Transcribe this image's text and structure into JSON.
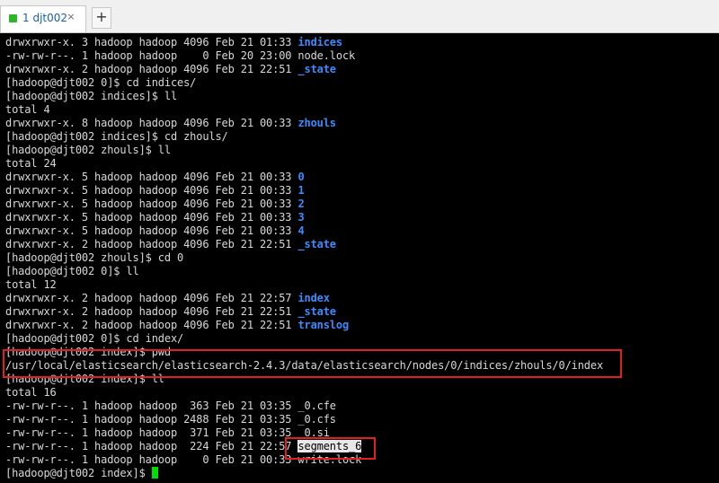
{
  "tab": {
    "label": "1 djt002",
    "close": "×",
    "new": "+"
  },
  "terminal": {
    "lines": [
      {
        "prefix": "drwxrwxr-x. 3 hadoop hadoop 4096 Feb 21 01:33 ",
        "name": "indices"
      },
      {
        "prefix": "-rw-rw-r--. 1 hadoop hadoop    0 Feb 20 23:00 node.lock",
        "name": ""
      },
      {
        "prefix": "drwxrwxr-x. 2 hadoop hadoop 4096 Feb 21 22:51 ",
        "name": "_state"
      },
      {
        "prefix": "[hadoop@djt002 0]$ cd indices/",
        "name": ""
      },
      {
        "prefix": "[hadoop@djt002 indices]$ ll",
        "name": ""
      },
      {
        "prefix": "total 4",
        "name": ""
      },
      {
        "prefix": "drwxrwxr-x. 8 hadoop hadoop 4096 Feb 21 00:33 ",
        "name": "zhouls"
      },
      {
        "prefix": "[hadoop@djt002 indices]$ cd zhouls/",
        "name": ""
      },
      {
        "prefix": "[hadoop@djt002 zhouls]$ ll",
        "name": ""
      },
      {
        "prefix": "total 24",
        "name": ""
      },
      {
        "prefix": "drwxrwxr-x. 5 hadoop hadoop 4096 Feb 21 00:33 ",
        "name": "0"
      },
      {
        "prefix": "drwxrwxr-x. 5 hadoop hadoop 4096 Feb 21 00:33 ",
        "name": "1"
      },
      {
        "prefix": "drwxrwxr-x. 5 hadoop hadoop 4096 Feb 21 00:33 ",
        "name": "2"
      },
      {
        "prefix": "drwxrwxr-x. 5 hadoop hadoop 4096 Feb 21 00:33 ",
        "name": "3"
      },
      {
        "prefix": "drwxrwxr-x. 5 hadoop hadoop 4096 Feb 21 00:33 ",
        "name": "4"
      },
      {
        "prefix": "drwxrwxr-x. 2 hadoop hadoop 4096 Feb 21 22:51 ",
        "name": "_state"
      },
      {
        "prefix": "[hadoop@djt002 zhouls]$ cd 0",
        "name": ""
      },
      {
        "prefix": "[hadoop@djt002 0]$ ll",
        "name": ""
      },
      {
        "prefix": "total 12",
        "name": ""
      },
      {
        "prefix": "drwxrwxr-x. 2 hadoop hadoop 4096 Feb 21 22:57 ",
        "name": "index"
      },
      {
        "prefix": "drwxrwxr-x. 2 hadoop hadoop 4096 Feb 21 22:51 ",
        "name": "_state"
      },
      {
        "prefix": "drwxrwxr-x. 2 hadoop hadoop 4096 Feb 21 22:51 ",
        "name": "translog"
      },
      {
        "prefix": "[hadoop@djt002 0]$ cd index/",
        "name": ""
      },
      {
        "prefix": "[hadoop@djt002 index]$ pwd",
        "name": ""
      },
      {
        "prefix": "/usr/local/elasticsearch/elasticsearch-2.4.3/data/elasticsearch/nodes/0/indices/zhouls/0/index",
        "name": ""
      },
      {
        "prefix": "[hadoop@djt002 index]$ ll",
        "name": ""
      },
      {
        "prefix": "total 16",
        "name": ""
      },
      {
        "prefix": "-rw-rw-r--. 1 hadoop hadoop  363 Feb 21 03:35 _0.cfe",
        "name": ""
      },
      {
        "prefix": "-rw-rw-r--. 1 hadoop hadoop 2488 Feb 21 03:35 _0.cfs",
        "name": ""
      },
      {
        "prefix": "-rw-rw-r--. 1 hadoop hadoop  371 Feb 21 03:35 _0.si",
        "name": ""
      },
      {
        "prefix": "-rw-rw-r--. 1 hadoop hadoop  224 Feb 21 22:57 ",
        "name": "",
        "selected": "segments_6"
      },
      {
        "prefix": "-rw-rw-r--. 1 hadoop hadoop    0 Feb 21 00:33 write.lock",
        "name": ""
      }
    ],
    "prompt": "[hadoop@djt002 index]$ "
  },
  "colors": {
    "directory": "#3a8cff",
    "text": "#d8d8d8",
    "highlight": "#e02020",
    "cursor": "#00e000"
  }
}
